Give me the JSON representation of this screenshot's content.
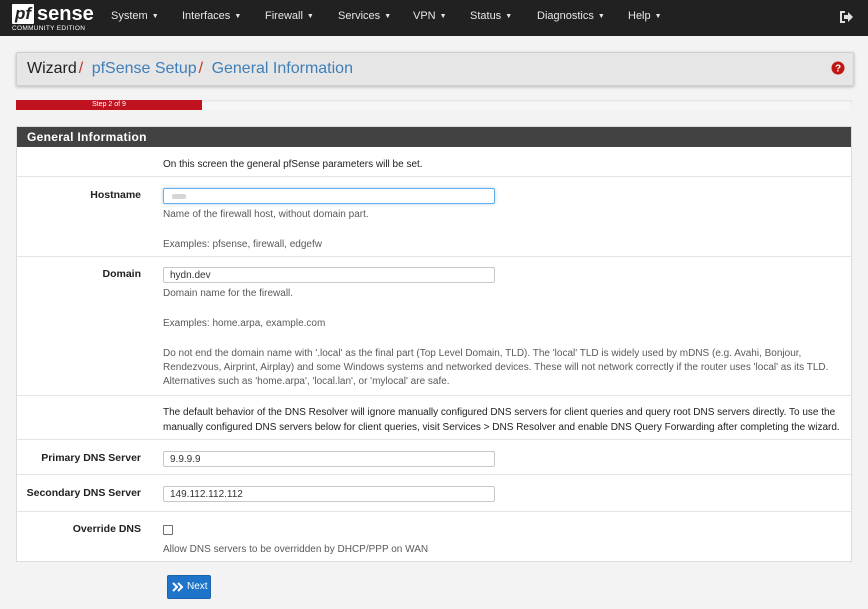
{
  "brand": {
    "part1": "pf",
    "part2": "sense",
    "edition": "COMMUNITY EDITION"
  },
  "nav": [
    {
      "label": "System"
    },
    {
      "label": "Interfaces"
    },
    {
      "label": "Firewall"
    },
    {
      "label": "Services"
    },
    {
      "label": "VPN"
    },
    {
      "label": "Status"
    },
    {
      "label": "Diagnostics"
    },
    {
      "label": "Help"
    }
  ],
  "breadcrumb": {
    "root": "Wizard",
    "sep": "/",
    "setup": "pfSense Setup",
    "page": "General Information"
  },
  "progress": {
    "label": "Step 2 of 9",
    "fraction": 0.222
  },
  "panel": {
    "title": "General Information",
    "intro": "On this screen the general pfSense parameters will be set.",
    "hostname": {
      "label": "Hostname",
      "value": "",
      "help1": "Name of the firewall host, without domain part.",
      "help2": "Examples: pfsense, firewall, edgefw"
    },
    "domain": {
      "label": "Domain",
      "value": "hydn.dev",
      "help1": "Domain name for the firewall.",
      "help2": "Examples: home.arpa, example.com",
      "help3_line1": "Do not end the domain name with '.local' as the final part (Top Level Domain, TLD). The 'local' TLD is widely used by mDNS (e.g. Avahi, Bonjour,",
      "help3_line2": "Rendezvous, Airprint, Airplay) and some Windows systems and networked devices. These will not network correctly if the router uses 'local' as its TLD.",
      "help3_line3": "Alternatives such as 'home.arpa', 'local.lan', or 'mylocal' are safe."
    },
    "dns_note_line1": "The default behavior of the DNS Resolver will ignore manually configured DNS servers for client queries and query root DNS servers directly. To use the",
    "dns_note_line2": "manually configured DNS servers below for client queries, visit Services > DNS Resolver and enable DNS Query Forwarding after completing the wizard.",
    "primary_dns": {
      "label": "Primary DNS Server",
      "value": "9.9.9.9"
    },
    "secondary_dns": {
      "label": "Secondary DNS Server",
      "value": "149.112.112.112"
    },
    "override_dns": {
      "label": "Override DNS",
      "help": "Allow DNS servers to be overridden by DHCP/PPP on WAN",
      "checked": false
    }
  },
  "next_button": {
    "label": "Next"
  },
  "colors": {
    "navbar": "#212121",
    "progress": "#c1121f",
    "accent": "#1e74c9",
    "link": "#3f7fb8"
  },
  "icons": [
    "logout-icon",
    "help-icon",
    "chevron-right-double-icon"
  ]
}
